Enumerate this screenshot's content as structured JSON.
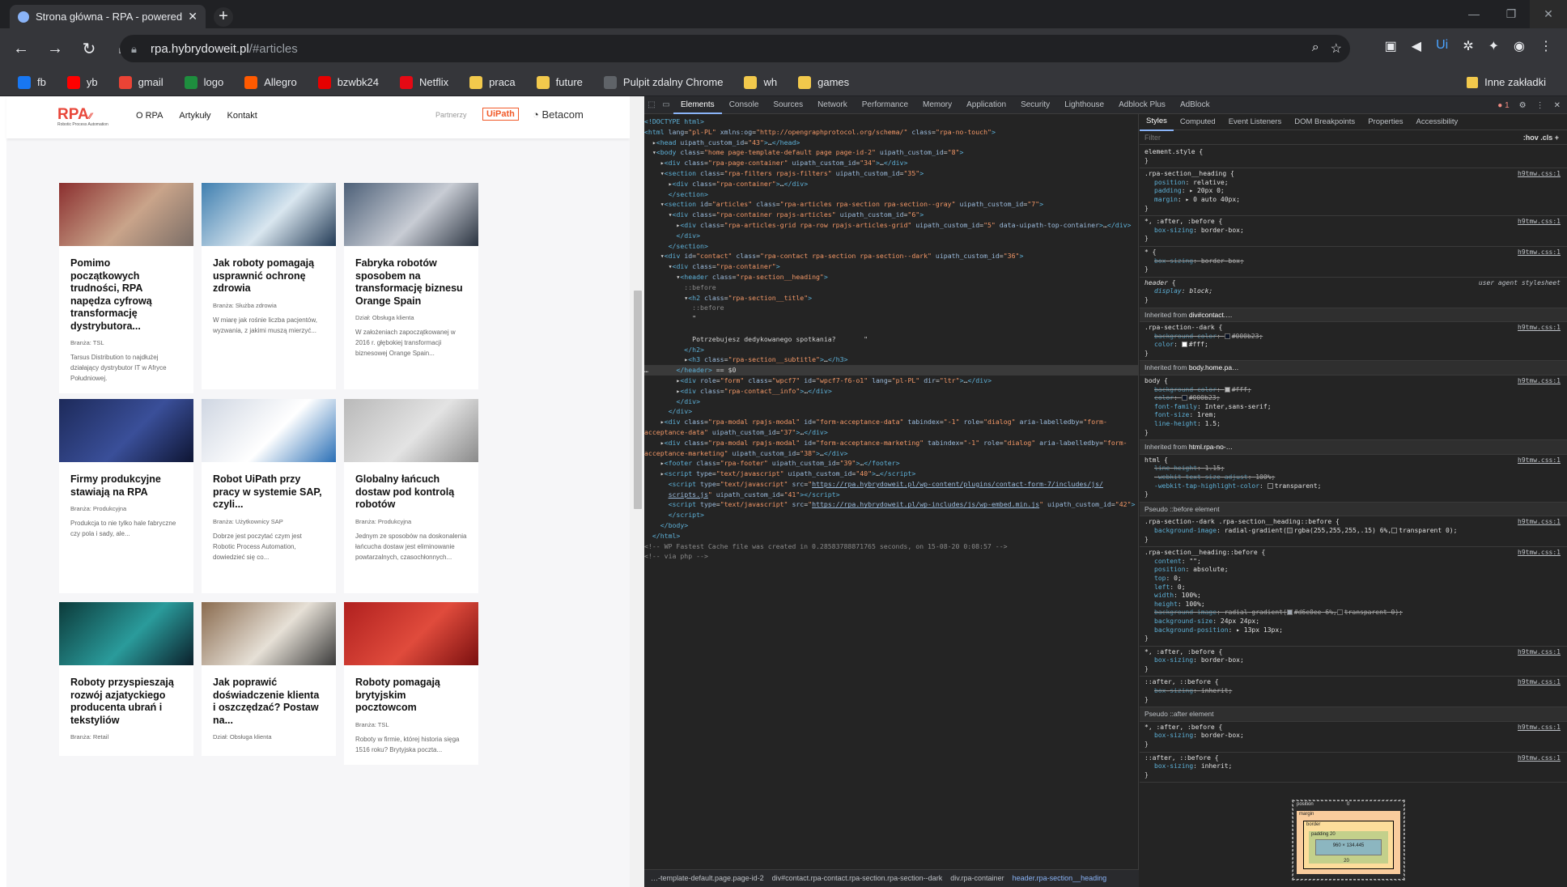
{
  "browser": {
    "tab_title": "Strona główna - RPA - powered l",
    "url_host": "rpa.hybrydoweit.pl",
    "url_path": "/#articles",
    "bookmarks": [
      {
        "label": "fb",
        "color": "#1877f2"
      },
      {
        "label": "yb",
        "color": "#ff0000"
      },
      {
        "label": "gmail",
        "color": "#ea4335"
      },
      {
        "label": "logo",
        "color": "#1e8e3e"
      },
      {
        "label": "Allegro",
        "color": "#ff5a00"
      },
      {
        "label": "bzwbk24",
        "color": "#e60000"
      },
      {
        "label": "Netflix",
        "color": "#e50914"
      },
      {
        "label": "praca",
        "color": "#f2c94c"
      },
      {
        "label": "future",
        "color": "#f2c94c"
      },
      {
        "label": "Pulpit zdalny Chrome",
        "color": "#5f6368"
      },
      {
        "label": "wh",
        "color": "#f2c94c"
      },
      {
        "label": "games",
        "color": "#f2c94c"
      }
    ],
    "other_bookmarks": "Inne zakładki"
  },
  "site": {
    "logo_text": "RPA",
    "logo_sub": "Robotic Process Automation",
    "menu": [
      "O RPA",
      "Artykuły",
      "Kontakt"
    ],
    "partners_label": "Partnerzy",
    "partner1": "UiPath",
    "partner2": "Betacom"
  },
  "articles": [
    {
      "title": "Pomimo początkowych trudności, RPA napędza cyfrową transformację dystrybutora...",
      "category": "Branża: TSL",
      "excerpt": "Tarsus Distribution to najdłużej działający dystrybutor IT w Afryce Południowej."
    },
    {
      "title": "Jak roboty pomagają usprawnić ochronę zdrowia",
      "category": "Branża: Służba zdrowia",
      "excerpt": "W miarę jak rośnie liczba pacjentów, wyzwania, z jakimi muszą mierzyć..."
    },
    {
      "title": "Fabryka robotów sposobem na transformację biznesu Orange Spain",
      "category": "Dział: Obsługa klienta",
      "excerpt": "W założeniach zapoczątkowanej w 2016 r. głębokiej transformacji biznesowej Orange Spain..."
    },
    {
      "title": "Firmy produkcyjne stawiają na RPA",
      "category": "Branża: Produkcyjna",
      "excerpt": "Produkcja to nie tylko hale fabryczne czy pola i sady, ale..."
    },
    {
      "title": "Robot UiPath przy pracy w systemie SAP, czyli...",
      "category": "Branża: Użytkownicy SAP",
      "excerpt": "Dobrze jest poczytać czym jest Robotic Process Automation, dowiedzieć się co..."
    },
    {
      "title": "Globalny łańcuch dostaw pod kontrolą robotów",
      "category": "Branża: Produkcyjna",
      "excerpt": "Jednym ze sposobów na doskonalenia łańcucha dostaw jest eliminowanie powtarzalnych, czasochłonnych..."
    },
    {
      "title": "Roboty przyspieszają rozwój azjatyckiego producenta ubrań i tekstyliów",
      "category": "Branża: Retail",
      "excerpt": ""
    },
    {
      "title": "Jak poprawić doświadczenie klienta i oszczędzać? Postaw na...",
      "category": "Dział: Obsługa klienta",
      "excerpt": ""
    },
    {
      "title": "Roboty pomagają brytyjskim pocztowcom",
      "category": "Branża: TSL",
      "excerpt": "Roboty w firmie, której historia sięga 1516 roku? Brytyjska poczta..."
    }
  ],
  "devtools": {
    "tabs": [
      "Elements",
      "Console",
      "Sources",
      "Network",
      "Performance",
      "Memory",
      "Application",
      "Security",
      "Lighthouse",
      "Adblock Plus",
      "AdBlock"
    ],
    "error_count": "1",
    "styles_tabs": [
      "Styles",
      "Computed",
      "Event Listeners",
      "DOM Breakpoints",
      "Properties",
      "Accessibility"
    ],
    "filter_placeholder": "Filter",
    "filter_right": ":hov  .cls  +",
    "breadcrumbs": [
      "…-template-default.page.page-id-2",
      "div#contact.rpa-contact.rpa-section.rpa-section--dark",
      "div.rpa-container",
      "header.rpa-section__heading"
    ],
    "boxmodel": {
      "position": "position",
      "position_val": "0",
      "margin": "margin",
      "border": "border",
      "padding": "padding 20",
      "content": "960 × 134.445",
      "pad_bottom": "20"
    }
  }
}
